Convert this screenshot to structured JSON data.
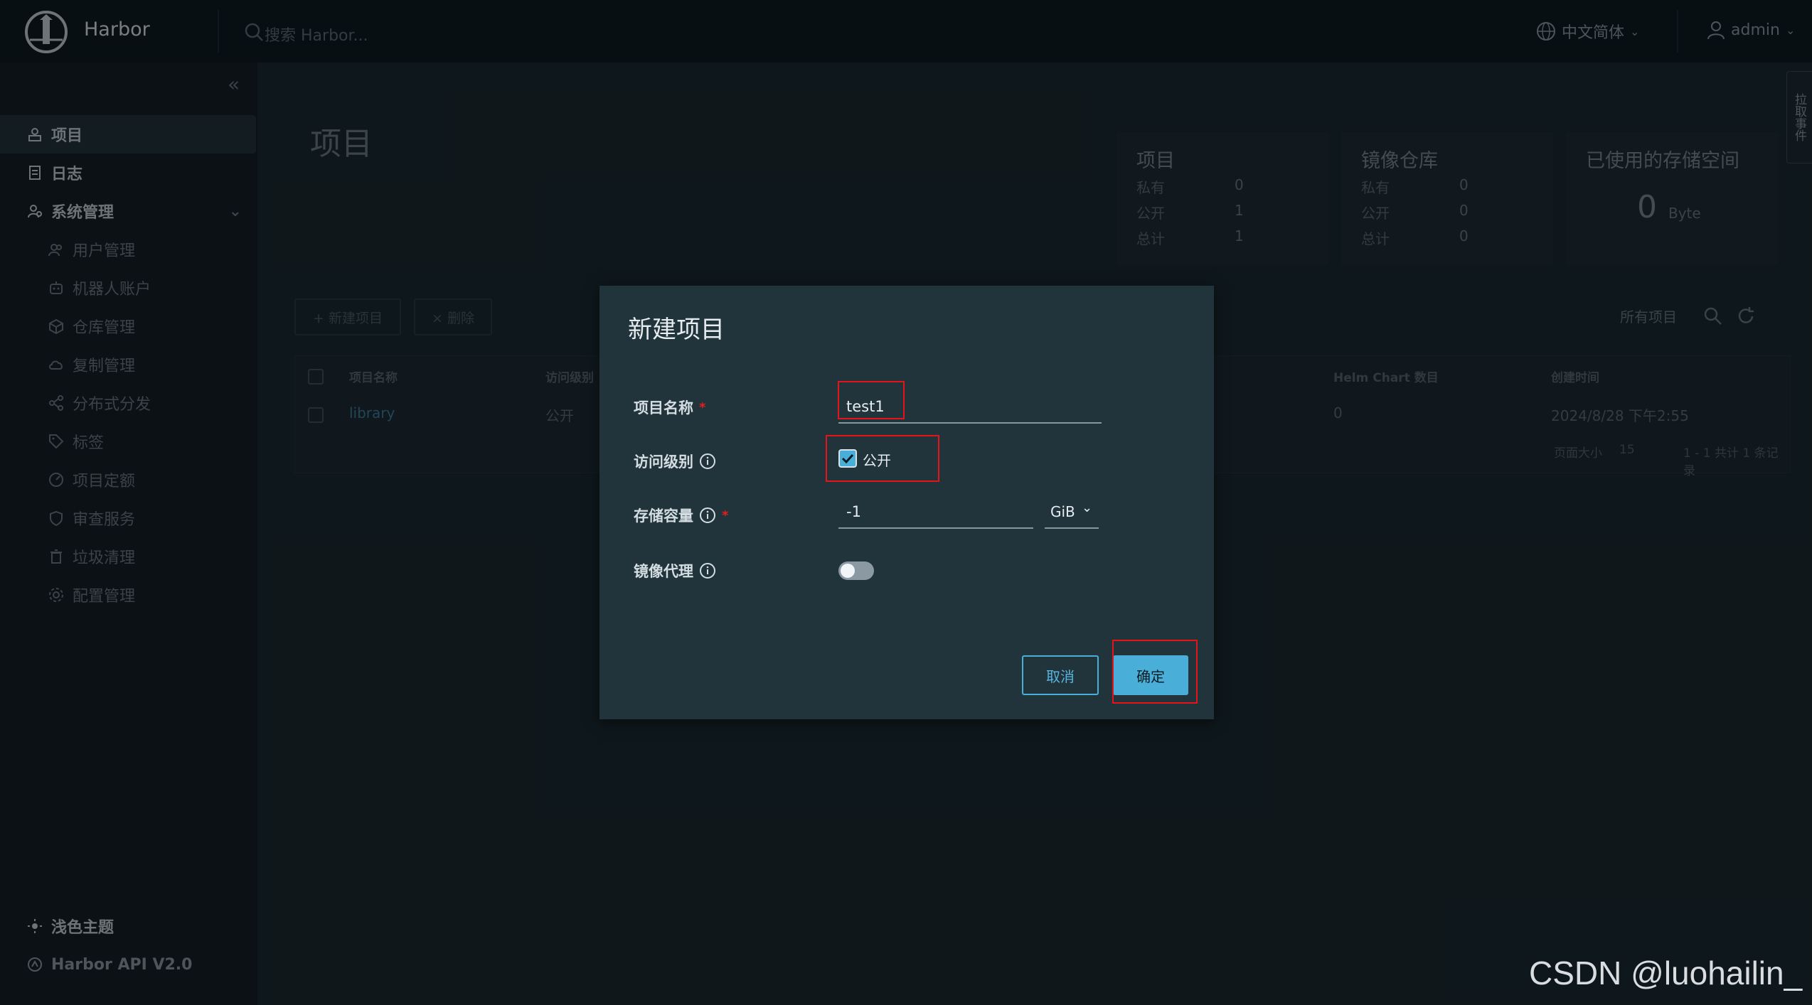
{
  "header": {
    "brand": "Harbor",
    "search_placeholder": "搜索 Harbor...",
    "language": "中文简体",
    "user": "admin"
  },
  "sidebar": {
    "items": [
      {
        "label": "项目",
        "icon": "project-icon",
        "active": true
      },
      {
        "label": "日志",
        "icon": "log-icon"
      },
      {
        "label": "系统管理",
        "icon": "admin-icon",
        "expandable": true
      }
    ],
    "sub_items": [
      {
        "label": "用户管理",
        "icon": "users-icon"
      },
      {
        "label": "机器人账户",
        "icon": "robot-icon"
      },
      {
        "label": "仓库管理",
        "icon": "cube-icon"
      },
      {
        "label": "复制管理",
        "icon": "cloud-icon"
      },
      {
        "label": "分布式分发",
        "icon": "share-icon"
      },
      {
        "label": "标签",
        "icon": "tag-icon"
      },
      {
        "label": "项目定额",
        "icon": "quota-icon"
      },
      {
        "label": "审查服务",
        "icon": "shield-icon"
      },
      {
        "label": "垃圾清理",
        "icon": "trash-icon"
      },
      {
        "label": "配置管理",
        "icon": "gear-icon"
      }
    ],
    "footer": [
      {
        "label": "浅色主题",
        "icon": "sun-icon"
      },
      {
        "label": "Harbor API V2.0",
        "icon": "api-icon"
      }
    ]
  },
  "page": {
    "title": "项目",
    "side_tab": "拉取事件"
  },
  "summary": {
    "projects": {
      "title": "项目",
      "private_label": "私有",
      "private": "0",
      "public_label": "公开",
      "public": "1",
      "total_label": "总计",
      "total": "1"
    },
    "repos": {
      "title": "镜像仓库",
      "private_label": "私有",
      "private": "0",
      "public_label": "公开",
      "public": "0",
      "total_label": "总计",
      "total": "0"
    },
    "storage": {
      "title": "已使用的存储空间",
      "value": "0",
      "unit": "Byte"
    }
  },
  "toolbar": {
    "new_project": "+ 新建项目",
    "delete": "× 删除",
    "filter": "所有项目"
  },
  "table": {
    "headers": [
      "项目名称",
      "访问级别",
      "Helm Chart 数目",
      "创建时间"
    ],
    "rows": [
      {
        "name": "library",
        "access": "公开",
        "helm": "0",
        "created": "2024/8/28 下午2:55"
      }
    ],
    "page_size_label": "页面大小",
    "page_size": "15",
    "summary": "1 - 1 共计 1 条记录"
  },
  "modal": {
    "title": "新建项目",
    "name_label": "项目名称",
    "name_value": "test1",
    "access_label": "访问级别",
    "access_public": "公开",
    "access_checked": true,
    "storage_label": "存储容量",
    "storage_value": "-1",
    "storage_unit": "GiB",
    "proxy_label": "镜像代理",
    "proxy_enabled": false,
    "cancel": "取消",
    "confirm": "确定"
  },
  "watermark": "CSDN @luohailin_"
}
